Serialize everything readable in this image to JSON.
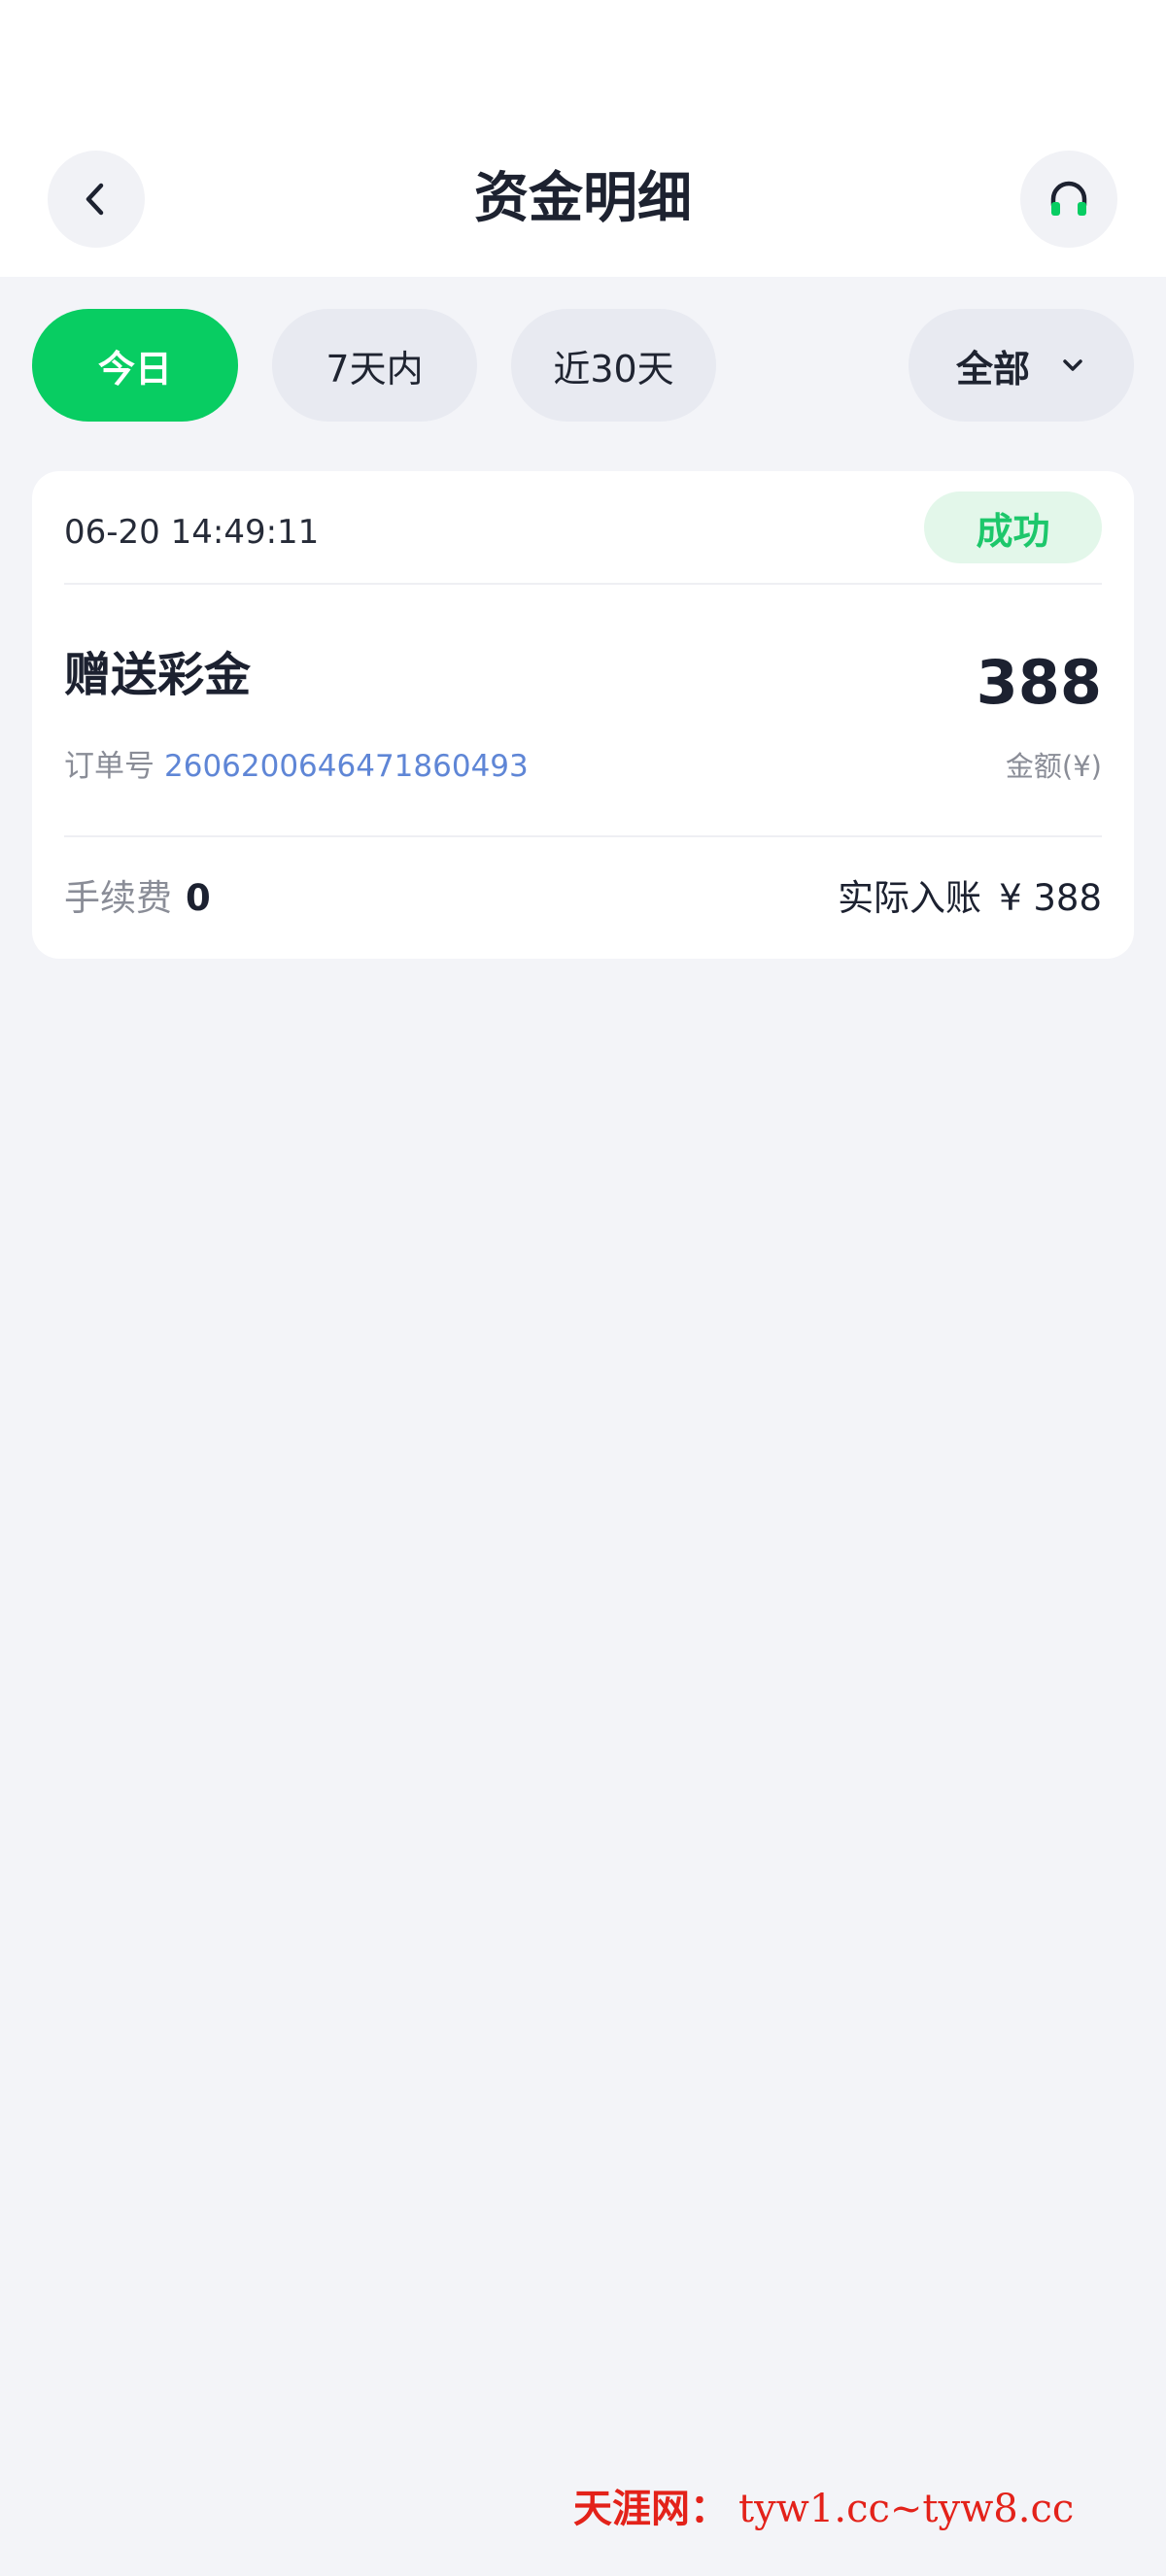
{
  "header": {
    "title": "资金明细",
    "back_icon": "back-icon",
    "service_icon": "headset-icon"
  },
  "filters": {
    "today": "今日",
    "seven_days": "7天内",
    "thirty_days": "近30天",
    "category": "全部",
    "active": "今日"
  },
  "record": {
    "time": "06-20 14:49:11",
    "status": "成功",
    "type": "赠送彩金",
    "amount": "388",
    "order_label": "订单号",
    "order_no": "2606200646471860493",
    "amount_label": "金额(¥)",
    "fee_label": "手续费",
    "fee_value": "0",
    "actual_label": "实际入账",
    "actual_value": "¥ 388"
  },
  "watermark": {
    "name": "天涯网：",
    "url": "tyw1.cc~tyw8.cc"
  },
  "colors": {
    "accent": "#08cd62",
    "status_bg": "#e3f7ea",
    "link": "#5f86d6",
    "background": "#f3f4f8"
  }
}
